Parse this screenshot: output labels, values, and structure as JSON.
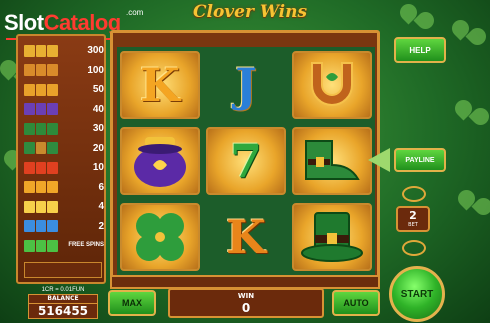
{
  "logo": {
    "word1": "Slot",
    "word2": "Catalog",
    "suffix": ".com"
  },
  "game_title": "Clover Wins",
  "paytable": [
    {
      "symbol": "three-clover-symbol",
      "value": "300",
      "colors": [
        "#e8b032",
        "#e8b032",
        "#e8b032"
      ]
    },
    {
      "symbol": "three-horseshoe-symbol",
      "value": "100",
      "colors": [
        "#d98b2a",
        "#d98b2a",
        "#d98b2a"
      ]
    },
    {
      "symbol": "three-seven-symbol",
      "value": "50",
      "colors": [
        "#e9a12a",
        "#e9a12a",
        "#e9a12a"
      ]
    },
    {
      "symbol": "three-pot-symbol",
      "value": "40",
      "colors": [
        "#6b3fb5",
        "#6b3fb5",
        "#6b3fb5"
      ]
    },
    {
      "symbol": "three-leprechaun-hat-symbol",
      "value": "30",
      "colors": [
        "#2e8a3a",
        "#2e8a3a",
        "#2e8a3a"
      ]
    },
    {
      "symbol": "three-shoe-symbol",
      "value": "20",
      "colors": [
        "#2f8b3f",
        "#c98a2d",
        "#2f8b3f"
      ]
    },
    {
      "symbol": "three-a-symbol",
      "value": "10",
      "colors": [
        "#e04020",
        "#e04020",
        "#e04020"
      ]
    },
    {
      "symbol": "three-k-symbol",
      "value": "6",
      "colors": [
        "#f0a628",
        "#f0a628",
        "#f0a628"
      ]
    },
    {
      "symbol": "three-q-symbol",
      "value": "4",
      "colors": [
        "#f7d04a",
        "#f7d04a",
        "#f7d04a"
      ]
    },
    {
      "symbol": "three-j-symbol",
      "value": "2",
      "colors": [
        "#3b8de0",
        "#3b8de0",
        "#3b8de0"
      ]
    },
    {
      "symbol": "three-scatter-symbol",
      "value": "FREE SPINS",
      "colors": [
        "#4cc144",
        "#4cc144",
        "#4cc144"
      ]
    }
  ],
  "reels": [
    [
      {
        "kind": "letter",
        "text": "K",
        "style": "gold",
        "bg": "gold"
      },
      {
        "kind": "pot",
        "name": "pot-of-gold-symbol",
        "bg": "gold"
      },
      {
        "kind": "clover",
        "name": "clover-symbol",
        "bg": "gold"
      }
    ],
    [
      {
        "kind": "letter",
        "text": "J",
        "style": "blue",
        "bg": "plain"
      },
      {
        "kind": "letter",
        "text": "7",
        "style": "green",
        "bg": "gold"
      },
      {
        "kind": "letter",
        "text": "K",
        "style": "orange",
        "bg": "plain"
      }
    ],
    [
      {
        "kind": "horseshoe",
        "name": "horseshoe-symbol",
        "bg": "gold"
      },
      {
        "kind": "shoe",
        "name": "leprechaun-shoe-symbol",
        "bg": "gold"
      },
      {
        "kind": "hat",
        "name": "leprechaun-hat-symbol",
        "bg": "gold"
      }
    ]
  ],
  "controls": {
    "help": "HELP",
    "payline": "PAYLINE",
    "bet_value": "2",
    "bet_label": "BET",
    "start": "START",
    "max": "MAX",
    "auto": "AUTO"
  },
  "status": {
    "credit": "1CR = 0.01FUN",
    "balance_label": "BALANCE",
    "balance": "516455",
    "win_label": "WIN",
    "win": "0"
  },
  "colors": {
    "frame": "#d79234",
    "panel": "#6b2a0c",
    "button": "#20901c"
  }
}
